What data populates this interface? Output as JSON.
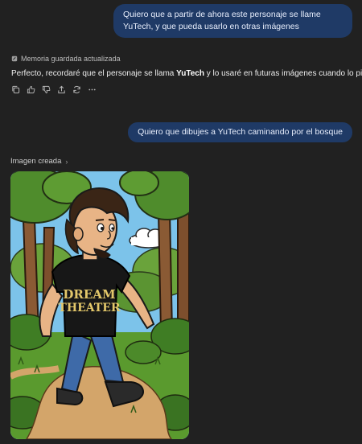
{
  "messages": {
    "user_1": "Quiero que a partir de ahora este personaje se llame YuTech, y que pueda usarlo en otras imágenes",
    "memory_status": "Memoria guardada actualizada",
    "assistant_reply_before": "Perfecto, recordaré que el personaje se llama ",
    "assistant_reply_bold": "YuTech",
    "assistant_reply_after": " y lo usaré en futuras imágenes cuando lo pidas.",
    "user_2": "Quiero que dibujes a YuTech caminando por el bosque"
  },
  "action_icons": [
    "copy-icon",
    "thumbs-up-icon",
    "thumbs-down-icon",
    "share-icon",
    "regenerate-icon",
    "more-icon"
  ],
  "image_block": {
    "label": "Imagen creada",
    "chevron": "›",
    "shirt_line1": "DREAM",
    "shirt_line2": "THEATER"
  },
  "colors": {
    "background": "#212121",
    "user_bubble": "#1f3a66",
    "text": "#ececec"
  }
}
